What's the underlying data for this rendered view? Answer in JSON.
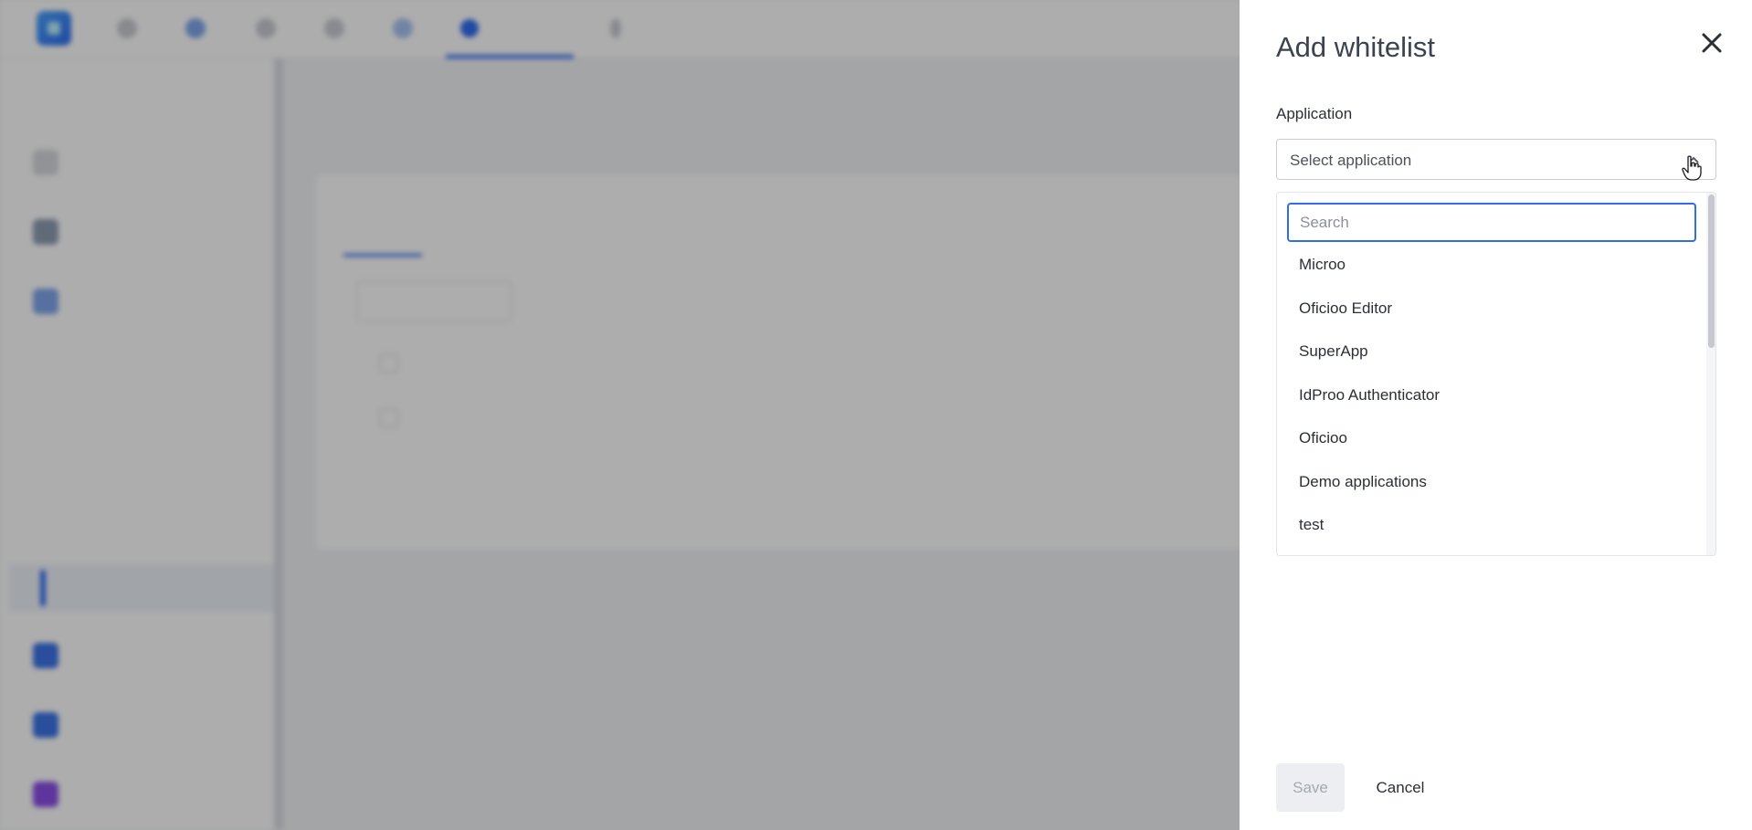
{
  "drawer": {
    "title": "Add whitelist",
    "close_icon": "close-icon",
    "field_label": "Application",
    "select_placeholder": "Select application",
    "search_placeholder": "Search",
    "options": [
      "Microo",
      "Oficioo Editor",
      "SuperApp",
      "IdProo Authenticator",
      "Oficioo",
      "Demo applications",
      "test"
    ],
    "save_label": "Save",
    "cancel_label": "Cancel"
  },
  "colors": {
    "accent": "#2f6cf0",
    "overlay": "rgba(0,0,0,0.32)",
    "drawer_bg": "#ffffff",
    "disabled_button": "#eceef1"
  }
}
